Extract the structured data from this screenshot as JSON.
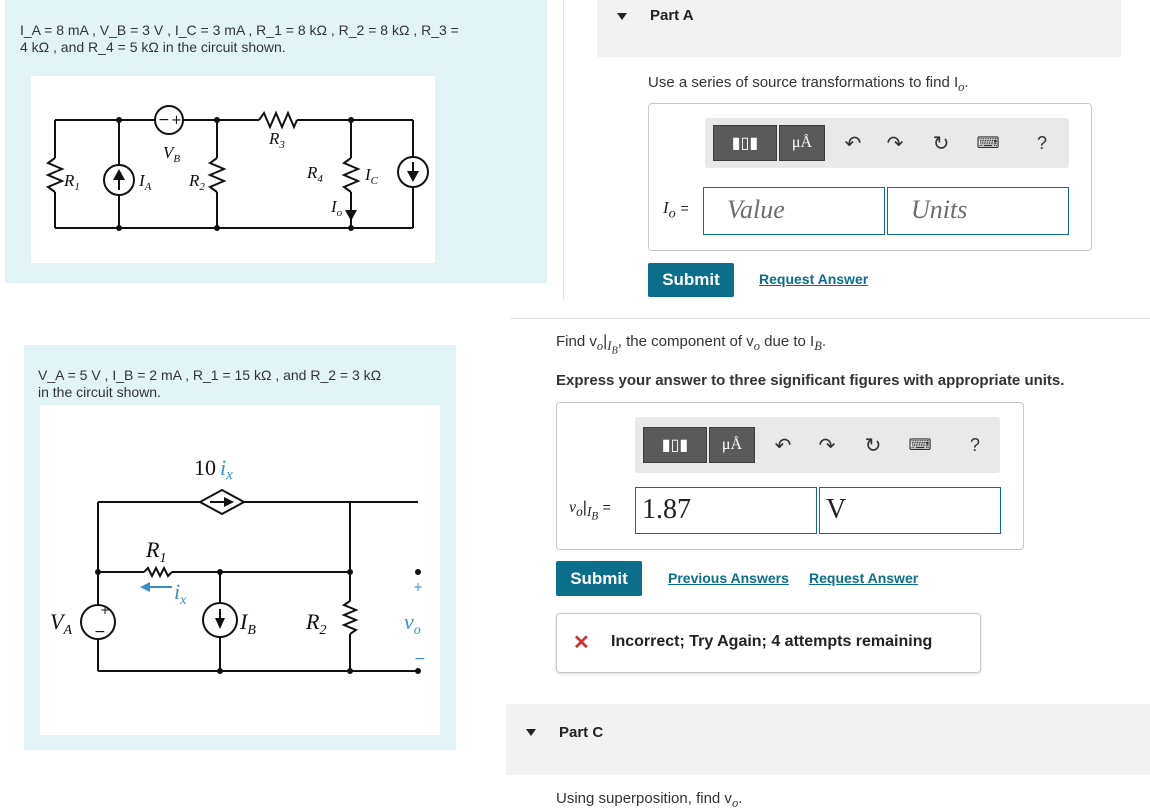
{
  "problem1": {
    "line1": "I_A = 8 mA , V_B = 3 V , I_C = 3 mA , R_1 = 8 kΩ , R_2 = 8 kΩ , R_3 =",
    "line2": "4 kΩ , and R_4 = 5 kΩ in the circuit shown.",
    "circuit_labels": {
      "vb": "V",
      "vb_sub": "B",
      "r1": "R",
      "r1_sub": "1",
      "ia": "I",
      "ia_sub": "A",
      "r2": "R",
      "r2_sub": "2",
      "r3": "R",
      "r3_sub": "3",
      "r4": "R",
      "r4_sub": "4",
      "ic": "I",
      "ic_sub": "C",
      "io": "I",
      "io_sub": "o"
    }
  },
  "problem2": {
    "line1": "V_A = 5 V , I_B = 2 mA , R_1 = 15 kΩ , and R_2 = 3 kΩ",
    "line2": "in the circuit shown.",
    "circuit_labels": {
      "dep": "10",
      "dep_var": "i",
      "dep_var_sub": "x",
      "r1": "R",
      "r1_sub": "1",
      "ix": "i",
      "ix_sub": "x",
      "va": "V",
      "va_sub": "A",
      "ib": "I",
      "ib_sub": "B",
      "r2": "R",
      "r2_sub": "2",
      "vo": "v",
      "vo_sub": "o",
      "plus": "+",
      "minus": "−"
    }
  },
  "partA": {
    "title": "Part A",
    "prompt": "Use a series of source transformations to find I",
    "prompt_sub": "o",
    "prompt_end": ".",
    "var_label": "I",
    "var_sub": "o",
    "equals": "=",
    "value_placeholder": "Value",
    "units_placeholder": "Units",
    "toolbar": {
      "mu_label": "μÅ",
      "help": "?"
    },
    "submit_label": "Submit",
    "request_label": "Request Answer"
  },
  "partB": {
    "prompt_start": "Find v",
    "prompt_sub": "o",
    "prompt_bar_sub": "I",
    "prompt_bar_subsub": "B",
    "prompt_mid": ", the component of v",
    "prompt_mid_sub": "o",
    "prompt_end": " due to I",
    "prompt_end_sub": "B",
    "prompt_period": ".",
    "instruction": "Express your answer to three significant figures with appropriate units.",
    "var_label": "v",
    "var_sub": "o",
    "var_bar_sub": "I",
    "var_bar_subsub": "B",
    "equals": "=",
    "value": "1.87",
    "units": "V",
    "toolbar": {
      "mu_label": "μÅ",
      "help": "?"
    },
    "submit_label": "Submit",
    "previous_label": "Previous Answers",
    "request_label": "Request Answer",
    "feedback_icon": "✕",
    "feedback": "Incorrect; Try Again; 4 attempts remaining"
  },
  "partC": {
    "title": "Part C",
    "prompt": "Using superposition, find v",
    "prompt_sub": "o",
    "prompt_end": "."
  },
  "colors": {
    "accent": "#0b6e8a",
    "panel": "#e3f4f7",
    "error": "#d32f2f"
  }
}
